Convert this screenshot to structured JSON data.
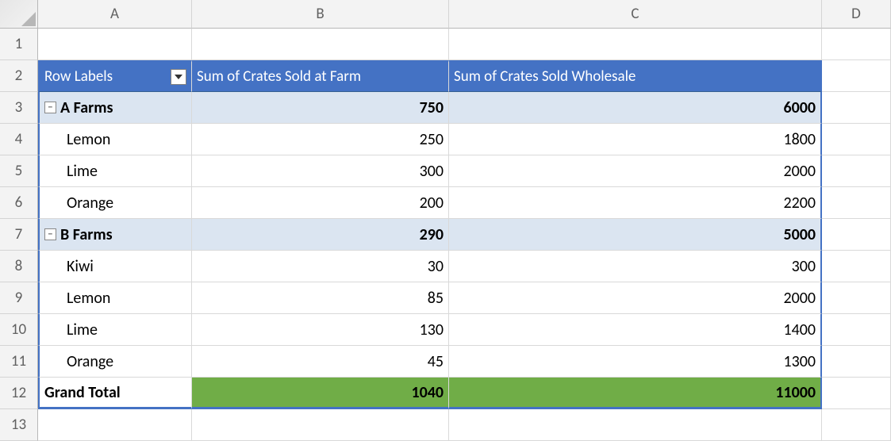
{
  "columns": [
    "A",
    "B",
    "C",
    "D"
  ],
  "rows": [
    "1",
    "2",
    "3",
    "4",
    "5",
    "6",
    "7",
    "8",
    "9",
    "10",
    "11",
    "12",
    "13"
  ],
  "pivot": {
    "headers": {
      "row_labels": "Row Labels",
      "col_b": "Sum of Crates Sold at Farm",
      "col_c": "Sum of Crates Sold Wholesale"
    },
    "groups": [
      {
        "label": "A Farms",
        "subtotal_b": "750",
        "subtotal_c": "6000",
        "items": [
          {
            "label": "Lemon",
            "b": "250",
            "c": "1800"
          },
          {
            "label": "Lime",
            "b": "300",
            "c": "2000"
          },
          {
            "label": "Orange",
            "b": "200",
            "c": "2200"
          }
        ]
      },
      {
        "label": "B Farms",
        "subtotal_b": "290",
        "subtotal_c": "5000",
        "items": [
          {
            "label": "Kiwi",
            "b": "30",
            "c": "300"
          },
          {
            "label": "Lemon",
            "b": "85",
            "c": "2000"
          },
          {
            "label": "Lime",
            "b": "130",
            "c": "1400"
          },
          {
            "label": "Orange",
            "b": "45",
            "c": "1300"
          }
        ]
      }
    ],
    "grand_total": {
      "label": "Grand Total",
      "b": "1040",
      "c": "11000"
    }
  }
}
